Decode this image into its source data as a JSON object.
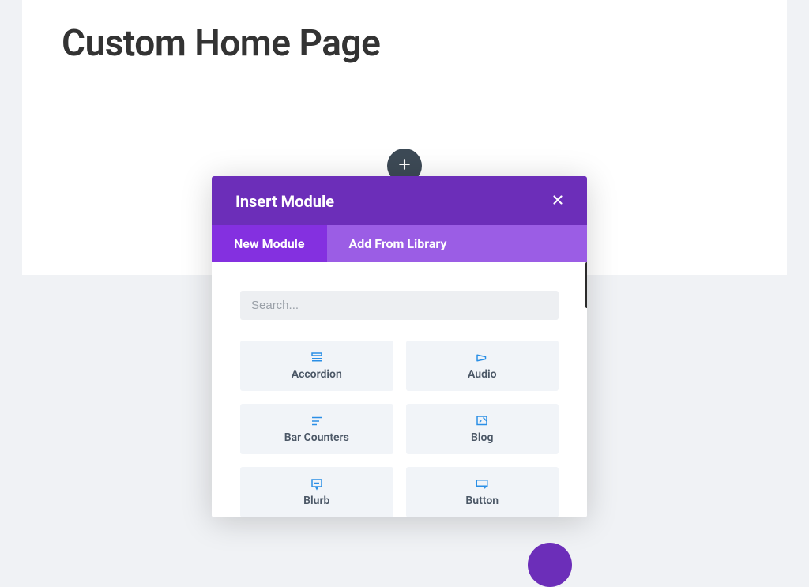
{
  "page": {
    "title": "Custom Home Page"
  },
  "modal": {
    "title": "Insert Module",
    "tabs": [
      {
        "label": "New Module",
        "active": true
      },
      {
        "label": "Add From Library",
        "active": false
      }
    ],
    "search": {
      "placeholder": "Search..."
    },
    "modules": [
      {
        "label": "Accordion",
        "icon": "accordion-icon"
      },
      {
        "label": "Audio",
        "icon": "audio-icon"
      },
      {
        "label": "Bar Counters",
        "icon": "bar-counters-icon"
      },
      {
        "label": "Blog",
        "icon": "blog-icon"
      },
      {
        "label": "Blurb",
        "icon": "blurb-icon"
      },
      {
        "label": "Button",
        "icon": "button-icon"
      }
    ]
  },
  "colors": {
    "primary": "#6c2eb9",
    "tab_bg": "#9b5de5",
    "tab_active": "#8430e0",
    "icon": "#2a8fe6"
  }
}
